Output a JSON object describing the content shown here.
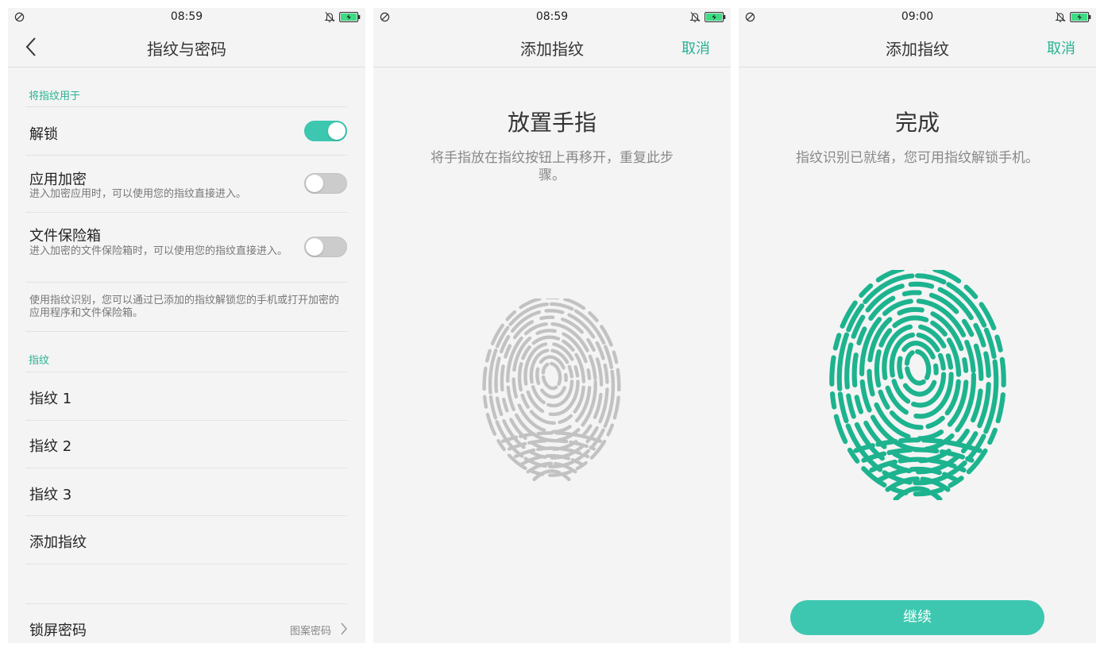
{
  "colors": {
    "accent": "#28b294",
    "toggle_on": "#3ec7b0",
    "fingerprint_idle": "#c2c2c2",
    "fingerprint_done": "#1db38f",
    "battery": "#3ddc84"
  },
  "screen1": {
    "status": {
      "time": "08:59",
      "icons": [
        "dnd-icon",
        "bell-muted-icon",
        "battery-charging-icon"
      ]
    },
    "header": {
      "title": "指纹与密码",
      "back_icon": "chevron-left-icon"
    },
    "use_section": {
      "heading": "将指纹用于",
      "items": [
        {
          "label": "解锁",
          "toggle": "on"
        },
        {
          "label": "应用加密",
          "sub": "进入加密应用时，可以使用您的指纹直接进入。",
          "toggle": "off"
        },
        {
          "label": "文件保险箱",
          "sub": "进入加密的文件保险箱时，可以使用您的指纹直接进入。",
          "toggle": "off"
        }
      ],
      "note": "使用指纹识别，您可以通过已添加的指纹解锁您的手机或打开加密的应用程序和文件保险箱。"
    },
    "fingerprint_section": {
      "heading": "指纹",
      "items": [
        "指纹 1",
        "指纹 2",
        "指纹 3",
        "添加指纹"
      ]
    },
    "lock_password": {
      "label": "锁屏密码",
      "value": "图案密码"
    }
  },
  "screen2": {
    "status": {
      "time": "08:59"
    },
    "header": {
      "title": "添加指纹",
      "cancel": "取消"
    },
    "big_title": "放置手指",
    "instruction": "将手指放在指纹按钮上再移开，重复此步骤。"
  },
  "screen3": {
    "status": {
      "time": "09:00"
    },
    "header": {
      "title": "添加指纹",
      "cancel": "取消"
    },
    "big_title": "完成",
    "instruction": "指纹识别已就绪，您可用指纹解锁手机。",
    "continue": "继续"
  }
}
